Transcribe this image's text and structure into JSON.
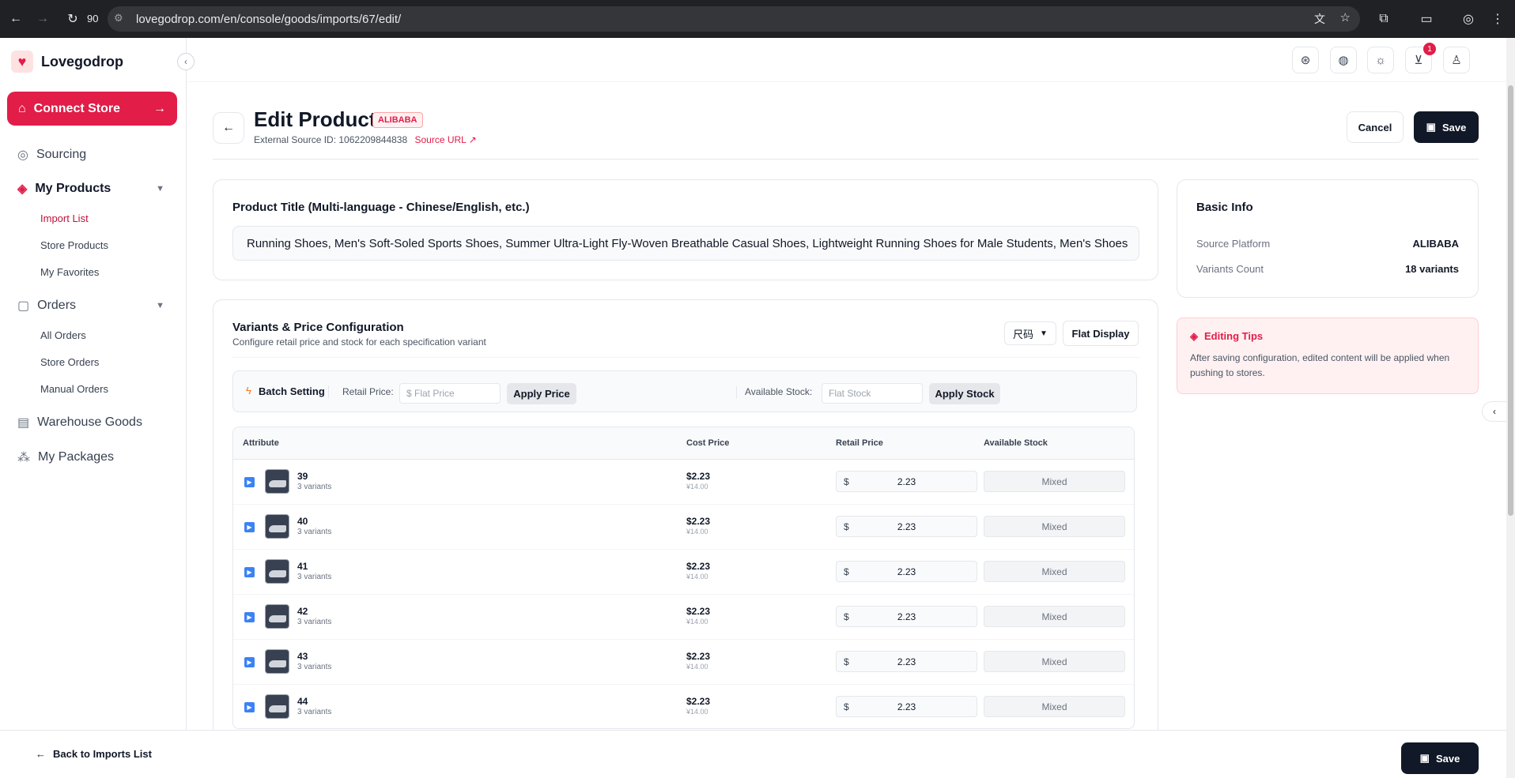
{
  "browser": {
    "url": "lovegodrop.com/en/console/goods/imports/67/edit/",
    "zoom": "90"
  },
  "sidebar": {
    "brand": "Lovegodrop",
    "connect_label": "Connect Store",
    "sourcing": "Sourcing",
    "my_products": "My Products",
    "import_list": "Import List",
    "store_products": "Store Products",
    "my_favorites": "My Favorites",
    "orders": "Orders",
    "all_orders": "All Orders",
    "store_orders": "Store Orders",
    "manual_orders": "Manual Orders",
    "warehouse_goods": "Warehouse Goods",
    "my_packages": "My Packages"
  },
  "header": {
    "cart_count": "1"
  },
  "page": {
    "title": "Edit Product",
    "source_tag": "ALIBABA",
    "external_id": "External Source ID: 1062209844838",
    "source_url": "Source URL",
    "cancel_label": "Cancel",
    "save_label": "Save"
  },
  "product_title": {
    "label": "Product Title (Multi-language - Chinese/English, etc.)",
    "value": "Running Shoes, Men's Soft-Soled Sports Shoes, Summer Ultra-Light Fly-Woven Breathable Casual Shoes, Lightweight Running Shoes for Male Students, Men's Shoes"
  },
  "basic_info": {
    "title": "Basic Info",
    "platform_label": "Source Platform",
    "platform_value": "ALIBABA",
    "variants_label": "Variants Count",
    "variants_value": "18 variants"
  },
  "tips": {
    "title": "Editing Tips",
    "text": "After saving configuration, edited content will be applied when pushing to stores."
  },
  "variants": {
    "title": "Variants & Price Configuration",
    "subtitle": "Configure retail price and stock for each specification variant",
    "group_select": "尺码",
    "flat_display": "Flat Display",
    "batch_label": "Batch Setting",
    "retail_label": "Retail Price:",
    "retail_placeholder": "$ Flat Price",
    "apply_price": "Apply Price",
    "stock_label": "Available Stock:",
    "stock_placeholder": "Flat Stock",
    "apply_stock": "Apply Stock",
    "columns": {
      "attribute": "Attribute",
      "cost": "Cost Price",
      "retail": "Retail Price",
      "stock": "Available Stock"
    },
    "rows": [
      {
        "attr": "39",
        "sub": "3 variants",
        "cost": "$2.23",
        "cny": "¥14.00",
        "currency": "$",
        "retail": "2.23",
        "stock": "Mixed"
      },
      {
        "attr": "40",
        "sub": "3 variants",
        "cost": "$2.23",
        "cny": "¥14.00",
        "currency": "$",
        "retail": "2.23",
        "stock": "Mixed"
      },
      {
        "attr": "41",
        "sub": "3 variants",
        "cost": "$2.23",
        "cny": "¥14.00",
        "currency": "$",
        "retail": "2.23",
        "stock": "Mixed"
      },
      {
        "attr": "42",
        "sub": "3 variants",
        "cost": "$2.23",
        "cny": "¥14.00",
        "currency": "$",
        "retail": "2.23",
        "stock": "Mixed"
      },
      {
        "attr": "43",
        "sub": "3 variants",
        "cost": "$2.23",
        "cny": "¥14.00",
        "currency": "$",
        "retail": "2.23",
        "stock": "Mixed"
      },
      {
        "attr": "44",
        "sub": "3 variants",
        "cost": "$2.23",
        "cny": "¥14.00",
        "currency": "$",
        "retail": "2.23",
        "stock": "Mixed"
      }
    ]
  },
  "footer": {
    "back_label": "Back to Imports List",
    "save_label": "Save"
  }
}
